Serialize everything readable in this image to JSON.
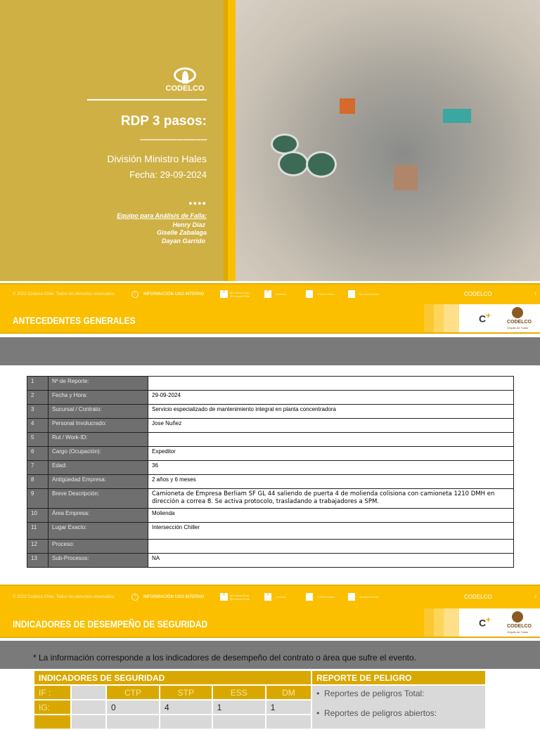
{
  "cover": {
    "logo": "CODELCO",
    "title": "RDP 3 pasos:",
    "dashes": "----------------------",
    "division": "División Ministro Hales",
    "date": "Fecha: 29-09-2024",
    "dots": "●●●●",
    "team_label": "Equipo para Análisis de Falla:",
    "team": [
      "Henry Diaz",
      "Giselle Zabalaga",
      "Dayan Garrido"
    ]
  },
  "footer": {
    "copyright": "© 2022 Codelco Chile. Todos los derechos reservados",
    "internal": "INFORMACIÓN USO INTERNO",
    "twitter": "@CodelcoCorp @CodelcoChile",
    "facebook": "/codelco",
    "youtube": "/ChileCodelco",
    "flickr": "/photos/codelco",
    "brand": "CODELCO",
    "brand_tag": "Orgullo de Todos"
  },
  "slide1": {
    "title": "ANTECEDENTES GENERALES",
    "page": "1",
    "rows": [
      {
        "n": "1",
        "label": "Nº de Reporte:",
        "value": ""
      },
      {
        "n": "2",
        "label": "Fecha y Hora:",
        "value": "29-09-2024"
      },
      {
        "n": "3",
        "label": "Sucursal / Contrato:",
        "value": "Servicio especializado de mantenimiento integral en planta concentradora"
      },
      {
        "n": "4",
        "label": "Personal Involucrado:",
        "value": "Jose Nuñez"
      },
      {
        "n": "5",
        "label": "Rut / Work-ID:",
        "value": ""
      },
      {
        "n": "6",
        "label": "Cargo (Ocupación):",
        "value": "Expeditor"
      },
      {
        "n": "7",
        "label": "Edad:",
        "value": "36"
      },
      {
        "n": "8",
        "label": "Antigüedad Empresa:",
        "value": "2 años y 6 meses"
      },
      {
        "n": "9",
        "label": "Breve Descripción:",
        "value": "Camioneta de Empresa Berliam SF GL 44 saliendo de puerta 4 de molienda colisiona con camioneta 1210 DMH en dirección a correa 8. Se activa protocolo, trasladando a trabajadores a SPM."
      },
      {
        "n": "10",
        "label": "Área Empresa:",
        "value": "Molienda"
      },
      {
        "n": "11",
        "label": "Lugar Exacto:",
        "value": "Intersección Chiller"
      },
      {
        "n": "12",
        "label": "Proceso:",
        "value": ""
      },
      {
        "n": "13",
        "label": "Sub-Procesos:",
        "value": "NA"
      }
    ]
  },
  "slide2": {
    "title": "INDICADORES DE DESEMPEÑO DE SEGURIDAD",
    "page": "2",
    "note": "* La información corresponde a los indicadores de desempeño del contrato o área que sufre el evento.",
    "ind_header": "INDICADORES DE SEGURIDAD",
    "rep_header": "REPORTE DE PELIGRO",
    "if_label": "IF :",
    "ig_label": "IG:",
    "cols": [
      "CTP",
      "STP",
      "ESS",
      "DM"
    ],
    "values": [
      "0",
      "4",
      "1",
      "1"
    ],
    "reports": [
      "Reportes de peligros Total:",
      "Reportes de peligros abiertos:"
    ]
  }
}
